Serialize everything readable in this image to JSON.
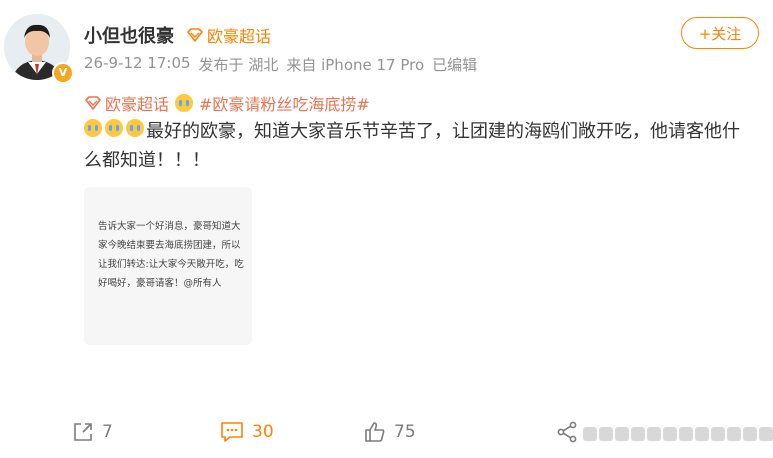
{
  "post": {
    "username": "小但也很豪",
    "supertopic_badge": "欧豪超话",
    "timestamp": "26-9-12 17:05",
    "posted_from": "发布于 湖北",
    "device": "来自 iPhone 17 Pro",
    "edited": "已编辑",
    "follow_label": "+关注",
    "tag_supertopic": "欧豪超话",
    "hashtag": "#欧豪请粉丝吃海底捞#",
    "body": "最好的欧豪，知道大家音乐节辛苦了，让团建的海鸥们敞开吃，他请客他什么都知道！！！",
    "image_text": "告诉大家一个好消息，豪哥知道大家今晚结束要去海底捞团建，所以让我们转达:让大家今天敞开吃，吃好喝好，豪哥请客！@所有人"
  },
  "actions": {
    "share_count": "7",
    "comment_count": "30",
    "like_count": "75"
  },
  "colors": {
    "accent": "#ff8200",
    "hashtag": "#eb7350",
    "meta": "#939393"
  },
  "icons": [
    "supertopic-diamond-icon",
    "crying-emoji-icon",
    "share-icon",
    "comment-icon",
    "like-icon",
    "repost-icon",
    "verified-badge-icon"
  ]
}
